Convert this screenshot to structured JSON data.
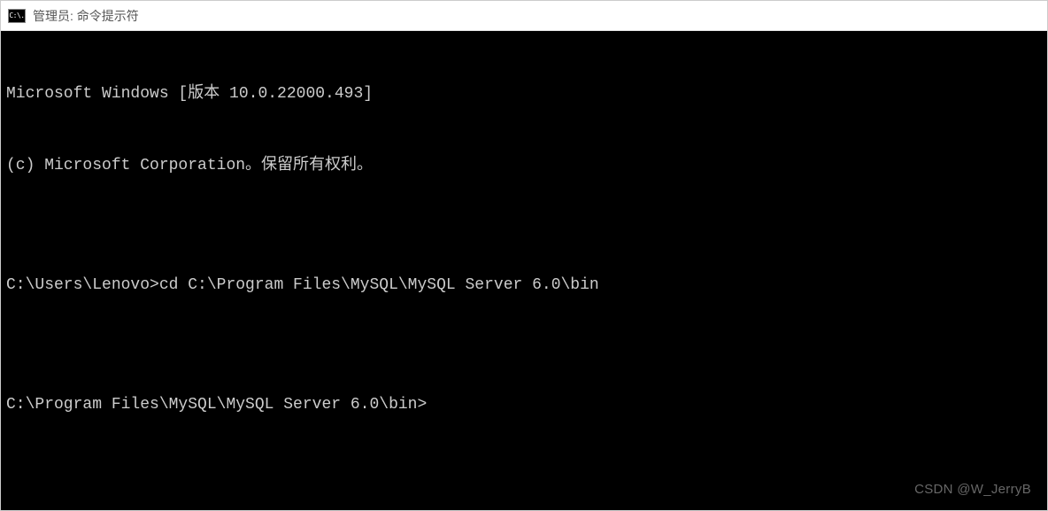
{
  "titlebar": {
    "icon_text": "C:\\.",
    "title": "管理员: 命令提示符"
  },
  "terminal": {
    "line1": "Microsoft Windows [版本 10.0.22000.493]",
    "line2": "(c) Microsoft Corporation。保留所有权利。",
    "blank1": "",
    "prompt1": "C:\\Users\\Lenovo>",
    "cmd1": "cd C:\\Program Files\\MySQL\\MySQL Server 6.0\\bin",
    "blank2": "",
    "prompt2": "C:\\Program Files\\MySQL\\MySQL Server 6.0\\bin>"
  },
  "watermark": "CSDN @W_JerryB"
}
